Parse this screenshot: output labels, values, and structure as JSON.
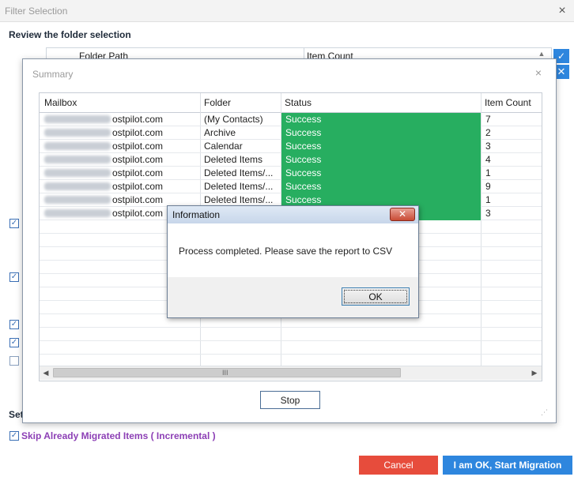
{
  "outer": {
    "title": "Filter Selection",
    "close_glyph": "×",
    "review_heading": "Review the folder selection",
    "folder_path_header": "Folder Path",
    "item_count_header": "Item Count",
    "side_check_glyph": "✓",
    "side_x_glyph": "✕",
    "set_label": "Set",
    "skip_label": "Skip Already Migrated Items ( Incremental )",
    "cancel_label": "Cancel",
    "start_label": "I am OK, Start Migration"
  },
  "summary": {
    "title": "Summary",
    "close_glyph": "×",
    "columns": [
      "Mailbox",
      "Folder",
      "Status",
      "Item Count"
    ],
    "rows": [
      {
        "mailbox": "ostpilot.com",
        "folder": "(My Contacts)",
        "status": "Success",
        "count": "7"
      },
      {
        "mailbox": "ostpilot.com",
        "folder": "Archive",
        "status": "Success",
        "count": "2"
      },
      {
        "mailbox": "ostpilot.com",
        "folder": "Calendar",
        "status": "Success",
        "count": "3"
      },
      {
        "mailbox": "ostpilot.com",
        "folder": "Deleted Items",
        "status": "Success",
        "count": "4"
      },
      {
        "mailbox": "ostpilot.com",
        "folder": "Deleted Items/...",
        "status": "Success",
        "count": "1"
      },
      {
        "mailbox": "ostpilot.com",
        "folder": "Deleted Items/...",
        "status": "Success",
        "count": "9"
      },
      {
        "mailbox": "ostpilot.com",
        "folder": "Deleted Items/...",
        "status": "Success",
        "count": "1"
      },
      {
        "mailbox": "ostpilot.com",
        "folder": "",
        "status": "",
        "count": "3"
      }
    ],
    "stop_label": "Stop",
    "scroll_grip": "III"
  },
  "info": {
    "title": "Information",
    "message": "Process completed. Please save the report to CSV",
    "ok_label": "OK",
    "close_glyph": "✕"
  },
  "colors": {
    "success": "#27ae60",
    "accent": "#2e86de",
    "cancel": "#e74c3c",
    "incremental_label": "#8c3fb5"
  }
}
